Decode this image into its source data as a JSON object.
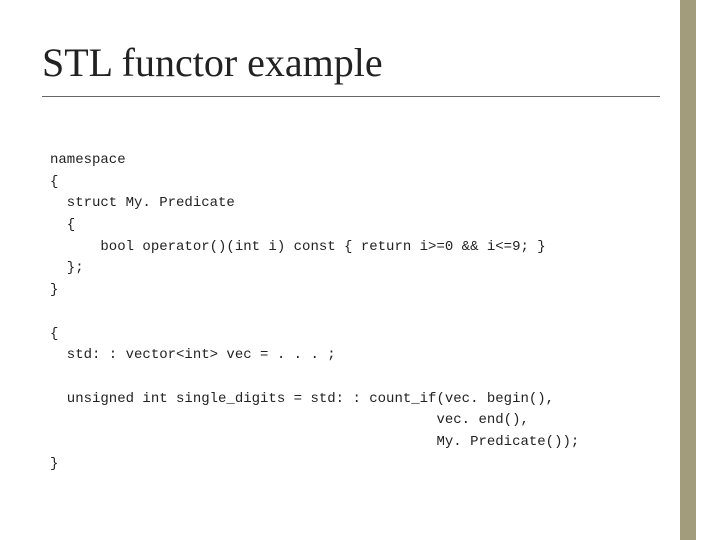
{
  "slide": {
    "title": "STL functor example",
    "code_lines": [
      "namespace",
      "{",
      "  struct My. Predicate",
      "  {",
      "      bool operator()(int i) const { return i>=0 && i<=9; }",
      "  };",
      "}",
      "",
      "{",
      "  std: : vector<int> vec = . . . ;",
      "",
      "  unsigned int single_digits = std: : count_if(vec. begin(),",
      "                                              vec. end(),",
      "                                              My. Predicate());",
      "}"
    ]
  }
}
